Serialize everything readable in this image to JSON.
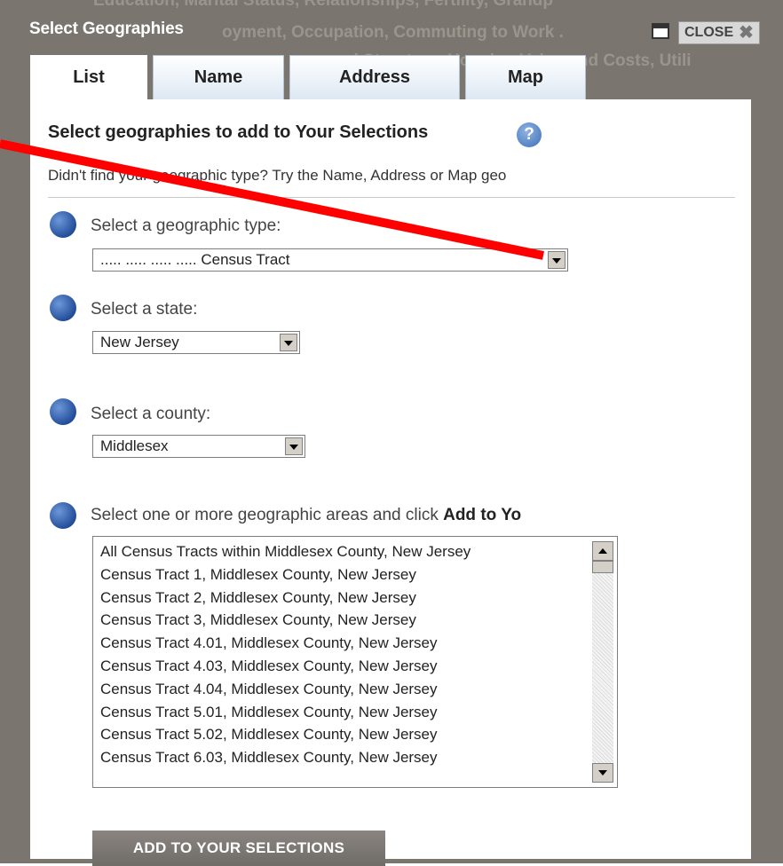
{
  "background_fragments": {
    "line1": "Education, Marital Status, Relationships, Fertility, Grandp",
    "line2": "oyment, Occupation, Commuting to Work .",
    "line3": "and Structure, Housing Value and Costs, Utili"
  },
  "dialog": {
    "title": "Select Geographies",
    "close_label": "CLOSE"
  },
  "tabs": [
    {
      "label": "List",
      "active": true
    },
    {
      "label": "Name",
      "active": false
    },
    {
      "label": "Address",
      "active": false
    },
    {
      "label": "Map",
      "active": false
    }
  ],
  "panel": {
    "heading": "Select geographies to add to Your Selections",
    "hint": "Didn't find your geographic type? Try the Name, Address or Map geo",
    "steps": {
      "type_label": "Select a geographic type:",
      "type_value": "..... ..... ..... ..... Census Tract",
      "state_label": "Select a state:",
      "state_value": "New Jersey",
      "county_label": "Select a county:",
      "county_value": "Middlesex",
      "areas_label_prefix": "Select one or more geographic areas and click ",
      "areas_label_bold": "Add to Yo"
    },
    "areas": [
      "All Census Tracts within Middlesex County, New Jersey",
      "Census Tract 1, Middlesex County, New Jersey",
      "Census Tract 2, Middlesex County, New Jersey",
      "Census Tract 3, Middlesex County, New Jersey",
      "Census Tract 4.01, Middlesex County, New Jersey",
      "Census Tract 4.03, Middlesex County, New Jersey",
      "Census Tract 4.04, Middlesex County, New Jersey",
      "Census Tract 5.01, Middlesex County, New Jersey",
      "Census Tract 5.02, Middlesex County, New Jersey",
      "Census Tract 6.03, Middlesex County, New Jersey"
    ],
    "add_button_label": "ADD TO YOUR SELECTIONS"
  },
  "icons": {
    "help": "help-icon",
    "maximize": "maximize-icon",
    "close": "close-icon",
    "annotation": "red-arrow-annotation"
  },
  "colors": {
    "frame": "#7a766f",
    "bullet": "#2b5aa8",
    "annotation": "#ff0000",
    "button": "#7a766f"
  }
}
